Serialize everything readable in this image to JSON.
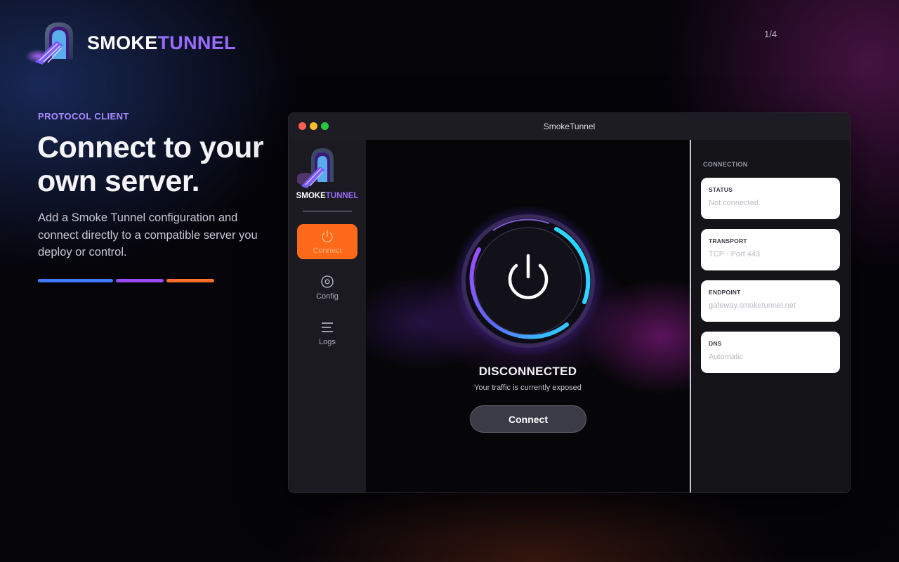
{
  "brand": {
    "name_part1": "SMOKE",
    "name_part2": "TUNNEL"
  },
  "pager": "1/4",
  "hero": {
    "eyebrow": "PROTOCOL CLIENT",
    "headline": "Connect to your own server.",
    "subtext": "Add a Smoke Tunnel configuration and connect directly to a compatible server you deploy or control."
  },
  "accent_colors": {
    "blue": "#3f7bff",
    "purple": "#9b4bff",
    "orange": "#ff6f2a"
  },
  "window": {
    "title": "SmokeTunnel",
    "sidebar": {
      "brand_part1": "SMOKE",
      "brand_part2": "TUNNEL",
      "items": [
        {
          "label": "Connect",
          "icon": "power-icon",
          "active": true
        },
        {
          "label": "Config",
          "icon": "target-icon",
          "active": false
        },
        {
          "label": "Logs",
          "icon": "list-icon",
          "active": false
        }
      ]
    },
    "main": {
      "status_title": "DISCONNECTED",
      "status_sub": "Your traffic is currently exposed",
      "connect_label": "Connect"
    },
    "panel": {
      "title": "CONNECTION",
      "cards": [
        {
          "label": "STATUS",
          "value": "Not connected"
        },
        {
          "label": "TRANSPORT",
          "value": "TCP · Port 443"
        },
        {
          "label": "ENDPOINT",
          "value": "gateway.smoketunnel.net"
        },
        {
          "label": "DNS",
          "value": "Automatic"
        }
      ]
    }
  }
}
